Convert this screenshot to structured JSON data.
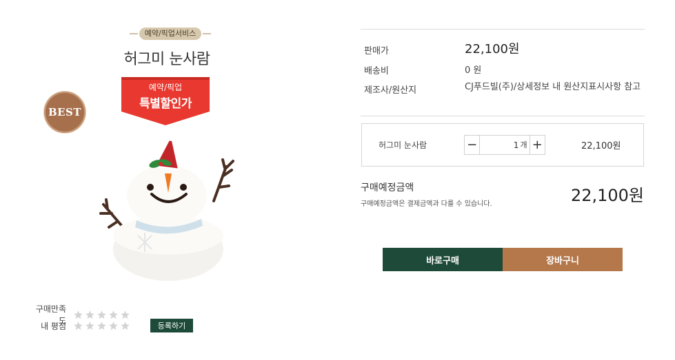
{
  "product": {
    "service_tag": "예약/픽업서비스",
    "title": "허그미 눈사람",
    "promo_small": "예약/픽업",
    "promo_big": "특별할인가",
    "best_badge": "BEST",
    "image_icon": "snowman-cake-image"
  },
  "rating": {
    "satisfaction_label": "구매만족도",
    "my_rating_label": "내 평점",
    "satisfaction_stars": 0,
    "my_rating_stars": 0,
    "max_stars": 5,
    "register_label": "등록하기"
  },
  "info": {
    "price_label": "판매가",
    "price_value": "22,100원",
    "shipping_label": "배송비",
    "shipping_value": "0 원",
    "origin_label": "제조사/원산지",
    "origin_value": "CJ푸드빌(주)/상세정보 내 원산지표시사항 참고"
  },
  "option": {
    "name": "허그미 눈사람",
    "quantity": "1",
    "unit": "개",
    "minus_label": "−",
    "plus_label": "+",
    "price": "22,100원"
  },
  "total": {
    "title": "구매예정금액",
    "note": "구매예정금액은 결제금액과 다를 수 있습니다.",
    "price": "22,100원"
  },
  "actions": {
    "buy_label": "바로구매",
    "cart_label": "장바구니"
  },
  "colors": {
    "primary": "#1e4a3a",
    "accent": "#b5784b",
    "promo_red": "#e8382f"
  }
}
